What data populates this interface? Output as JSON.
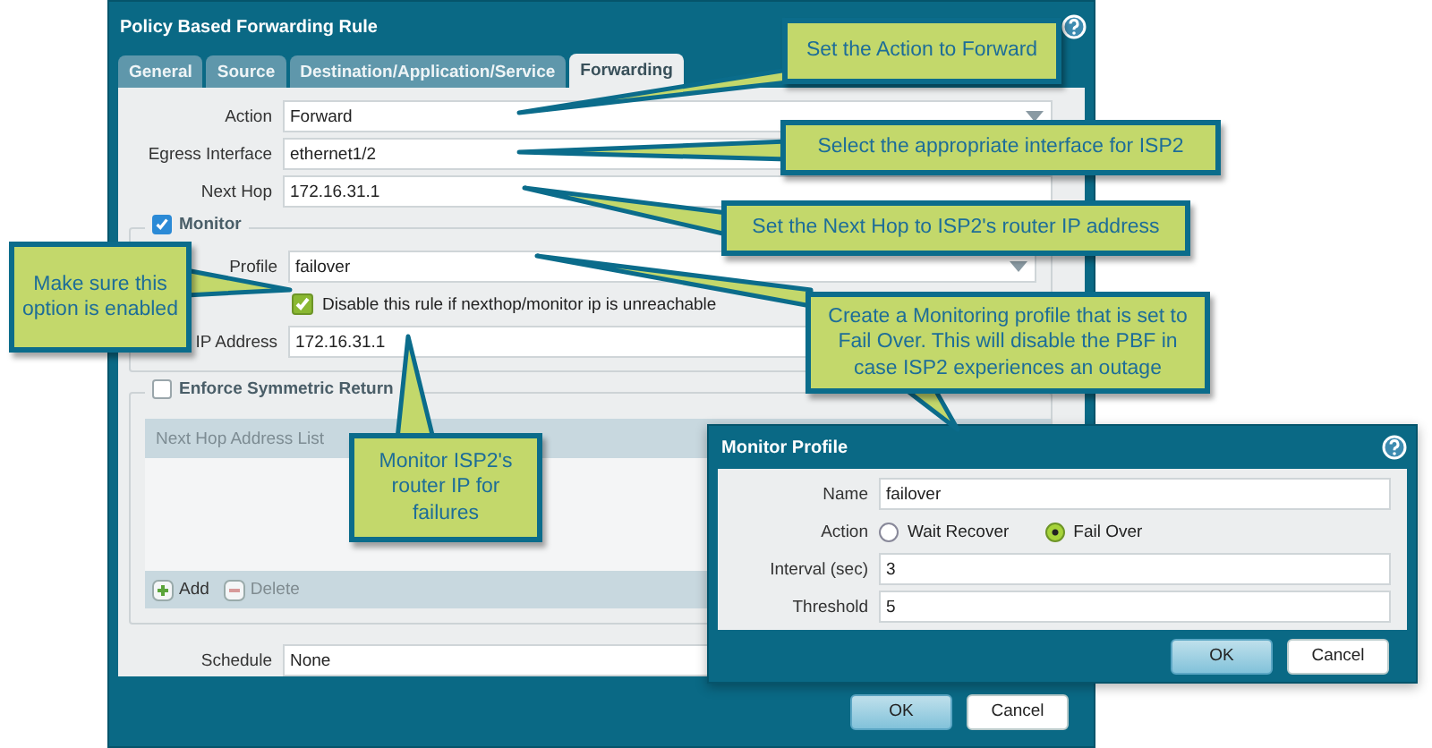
{
  "dialog": {
    "title": "Policy Based Forwarding Rule",
    "tabs": [
      {
        "label": "General",
        "selected": false
      },
      {
        "label": "Source",
        "selected": false
      },
      {
        "label": "Destination/Application/Service",
        "selected": false
      },
      {
        "label": "Forwarding",
        "selected": true
      }
    ],
    "fields": [
      {
        "label": "Action",
        "value": "Forward",
        "kind": "dropdown"
      },
      {
        "label": "Egress Interface",
        "value": "ethernet1/2",
        "kind": "text"
      },
      {
        "label": "Next Hop",
        "value": "172.16.31.1",
        "kind": "text"
      }
    ],
    "monitor": {
      "label": "Monitor",
      "checked": true,
      "profile": {
        "label": "Profile",
        "value": "failover"
      },
      "disable_option": {
        "label": "Disable this rule if nexthop/monitor ip is unreachable",
        "checked": true
      },
      "ip_address": {
        "label": "IP Address",
        "value": "172.16.31.1"
      }
    },
    "symmetric_return": {
      "label": "Enforce Symmetric Return",
      "checked": false,
      "list_header": "Next Hop Address List",
      "actions": [
        {
          "label": "Add",
          "kind": "add",
          "disabled": false
        },
        {
          "label": "Delete",
          "kind": "delete",
          "disabled": true
        }
      ]
    },
    "schedule": {
      "label": "Schedule",
      "value": "None"
    },
    "buttons": [
      {
        "label": "OK",
        "primary": true
      },
      {
        "label": "Cancel",
        "primary": false
      }
    ]
  },
  "monitor_profile": {
    "title": "Monitor Profile",
    "name": {
      "label": "Name",
      "value": "failover"
    },
    "action": {
      "label": "Action",
      "options": [
        {
          "label": "Wait Recover",
          "selected": false
        },
        {
          "label": "Fail Over",
          "selected": true
        }
      ]
    },
    "interval": {
      "label": "Interval (sec)",
      "value": "3"
    },
    "threshold": {
      "label": "Threshold",
      "value": "5"
    },
    "buttons": [
      {
        "label": "OK",
        "primary": true
      },
      {
        "label": "Cancel",
        "primary": false
      }
    ]
  },
  "callouts": [
    {
      "text": "Set the Action to Forward"
    },
    {
      "text": "Select the appropriate interface for ISP2"
    },
    {
      "text": "Set the Next Hop to ISP2's router IP address"
    },
    {
      "text": "Make sure this option is enabled"
    },
    {
      "text": "Create a Monitoring profile that is set to Fail Over. This will disable the PBF in case ISP2 experiences an outage"
    },
    {
      "text": "Monitor ISP2's router IP for failures"
    }
  ]
}
